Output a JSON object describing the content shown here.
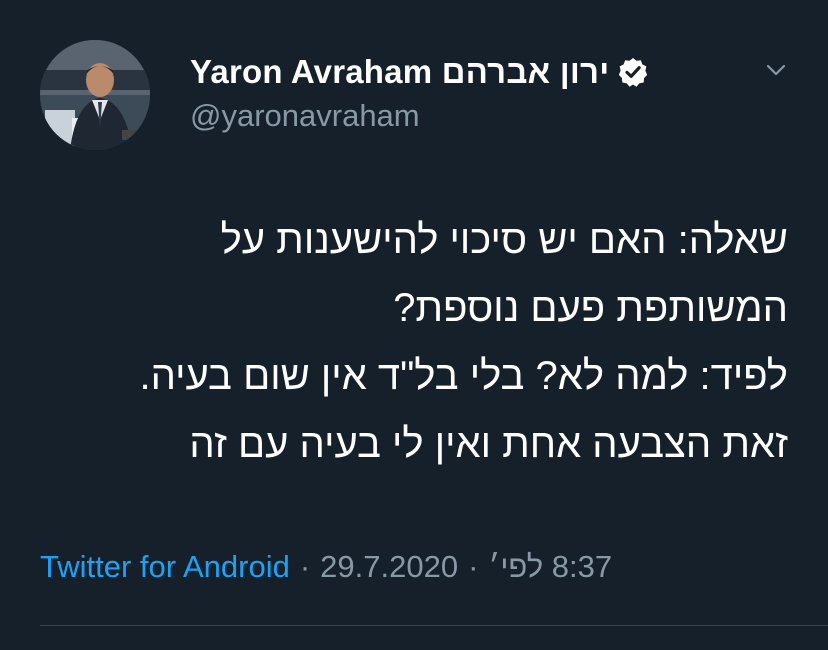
{
  "author": {
    "display_name": "Yaron Avraham ירון אברהם",
    "handle": "@yaronavraham",
    "verified_icon": "verified-badge-icon",
    "avatar_icon": "profile-photo"
  },
  "menu_icon": "chevron-down-icon",
  "tweet": {
    "lines": [
      "שאלה: האם יש סיכוי להישענות על",
      "המשותפת פעם נוספת?",
      "לפיד: למה לא? בלי בל\"ד אין שום בעיה.",
      "זאת הצבעה אחת ואין לי בעיה עם זה"
    ]
  },
  "meta": {
    "source": "Twitter for Android",
    "separator": "·",
    "date": "29.7.2020",
    "time": "8:37 לפי׳"
  },
  "colors": {
    "background": "#15202b",
    "text": "#ffffff",
    "muted": "#8899a6",
    "link": "#1da1f2",
    "divider": "#38444d"
  }
}
